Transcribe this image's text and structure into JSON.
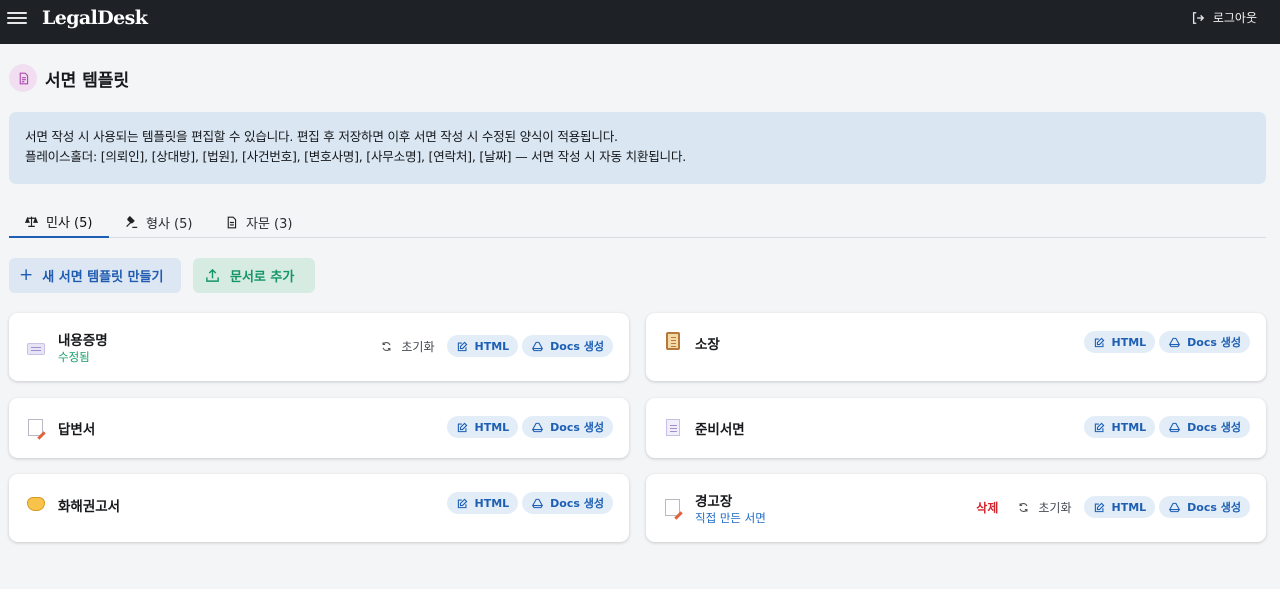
{
  "header": {
    "brand": "LegalDesk",
    "logout_label": "로그아웃"
  },
  "page": {
    "title": "서면 템플릿",
    "notice_line1": "서면 작성 시 사용되는 템플릿을 편집할 수 있습니다. 편집 후 저장하면 이후 서면 작성 시 수정된 양식이 적용됩니다.",
    "notice_line2": "플레이스홀더: [의뢰인], [상대방], [법원], [사건번호], [변호사명], [사무소명], [연락처], [날짜] — 서면 작성 시 자동 치환됩니다."
  },
  "tabs": [
    {
      "label": "민사 (5)",
      "icon": "scale-icon",
      "active": true
    },
    {
      "label": "형사 (5)",
      "icon": "gavel-icon",
      "active": false
    },
    {
      "label": "자문 (3)",
      "icon": "document-icon",
      "active": false
    }
  ],
  "actions": {
    "new_label": "새 서면 템플릿 만들기",
    "new_symbol": "+",
    "upload_label": "문서로 추가"
  },
  "common": {
    "html_label": "HTML",
    "docs_label": "Docs 생성",
    "reset_label": "초기화",
    "delete_label": "삭제"
  },
  "templates": [
    {
      "name": "내용증명",
      "subtitle": "수정됨",
      "icon": "scroll-icon",
      "has_reset": true,
      "has_delete": false
    },
    {
      "name": "소장",
      "subtitle": "",
      "icon": "clipboard-icon",
      "has_reset": false,
      "has_delete": false
    },
    {
      "name": "답변서",
      "subtitle": "",
      "icon": "memo-icon",
      "has_reset": false,
      "has_delete": false
    },
    {
      "name": "준비서면",
      "subtitle": "",
      "icon": "page-icon",
      "has_reset": false,
      "has_delete": false
    },
    {
      "name": "화해권고서",
      "subtitle": "",
      "icon": "handshake-icon",
      "has_reset": false,
      "has_delete": false
    },
    {
      "name": "경고장",
      "subtitle": "직접 만든 서면",
      "icon": "memo-icon",
      "has_reset": true,
      "has_delete": true
    }
  ],
  "colors": {
    "header_bg": "#1e2226",
    "accent_blue": "#1c5fb5",
    "accent_green": "#149568",
    "danger": "#d0282e",
    "notice_bg": "#dae6f2"
  }
}
